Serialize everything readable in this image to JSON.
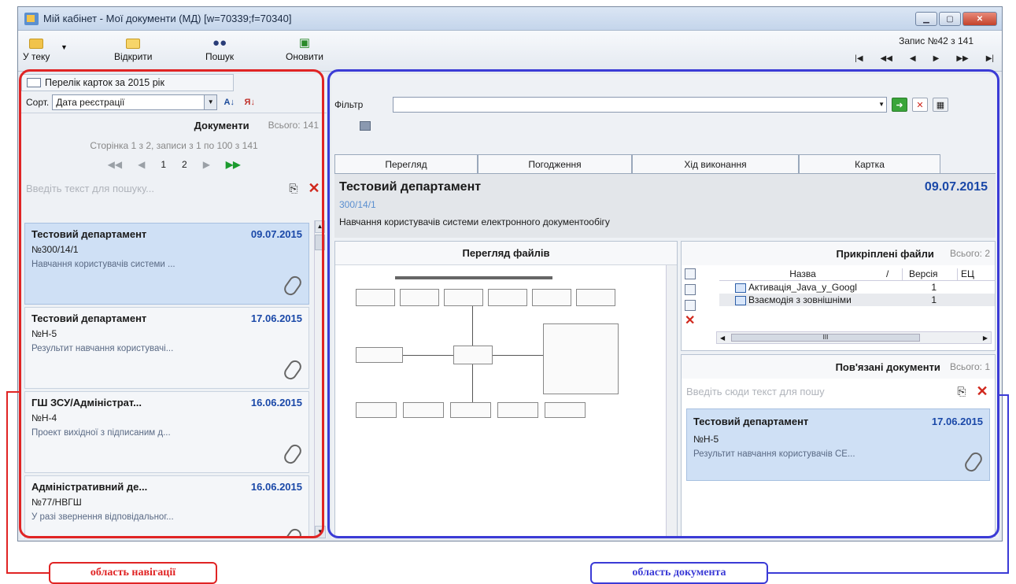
{
  "window": {
    "title": "Мій кабінет - Мої документи (МД) [w=70339;f=70340]"
  },
  "toolbar": {
    "to_folder": "У теку",
    "open": "Відкрити",
    "search": "Пошук",
    "refresh": "Оновити",
    "record": "Запис №42 з 141",
    "nav": [
      "|◀",
      "◀◀",
      "◀",
      "▶",
      "▶▶",
      "▶|"
    ]
  },
  "left": {
    "tab": "Перелік карток за 2015 рік",
    "sort_label": "Сорт.",
    "sort_value": "Дата реєстрації",
    "docs_title": "Документи",
    "docs_total": "Всього: 141",
    "page_info": "Сторінка 1 з 2, записи з 1 по 100 з 141",
    "pages": [
      "1",
      "2"
    ],
    "search_placeholder": "Введіть текст для пошуку...",
    "cards": [
      {
        "org": "Тестовий департамент",
        "date": "09.07.2015",
        "num": "№300/14/1",
        "desc": "Навчання користувачів системи ...",
        "selected": true
      },
      {
        "org": "Тестовий департамент",
        "date": "17.06.2015",
        "num": "№Н-5",
        "desc": "Результит навчання користувачі...",
        "selected": false
      },
      {
        "org": "ГШ ЗСУ/Адміністрат...",
        "date": "16.06.2015",
        "num": "№Н-4",
        "desc": "Проект вихідної з підписаним д...",
        "selected": false
      },
      {
        "org": "Адміністративний де...",
        "date": "16.06.2015",
        "num": "№77/НВГШ",
        "desc": "У разі звернення відповідальног...",
        "selected": false
      }
    ]
  },
  "right": {
    "filter_label": "Фільтр",
    "filter_value": "",
    "tabs": [
      "Перегляд",
      "Погодження",
      "Хід виконання",
      "Картка"
    ],
    "doc_org": "Тестовий департамент",
    "doc_date": "09.07.2015",
    "doc_ref": "300/14/1",
    "doc_subject": "Навчання користувачів системи електронного документообігу",
    "viewer_title": "Перегляд файлів",
    "files_title": "Прикріплені файли",
    "files_total": "Всього: 2",
    "files_cols": {
      "name": "Назва",
      "version": "Версія",
      "ec": "ЕЦ"
    },
    "files": [
      {
        "name": "Активація_Java_у_Googl",
        "version": "1"
      },
      {
        "name": "Взаємодія з зовнішніми",
        "version": "1"
      }
    ],
    "linked_title": "Пов'язані документи",
    "linked_total": "Всього: 1",
    "linked_placeholder": "Введіть сюди текст для пошу",
    "linked_card": {
      "org": "Тестовий департамент",
      "date": "17.06.2015",
      "num": "№Н-5",
      "desc": "Результит навчання користувачів СЕ..."
    }
  },
  "annotations": {
    "nav_area": "область навігації",
    "doc_area": "область документа",
    "nav_color": "#e02424",
    "doc_color": "#3b3bd6"
  }
}
